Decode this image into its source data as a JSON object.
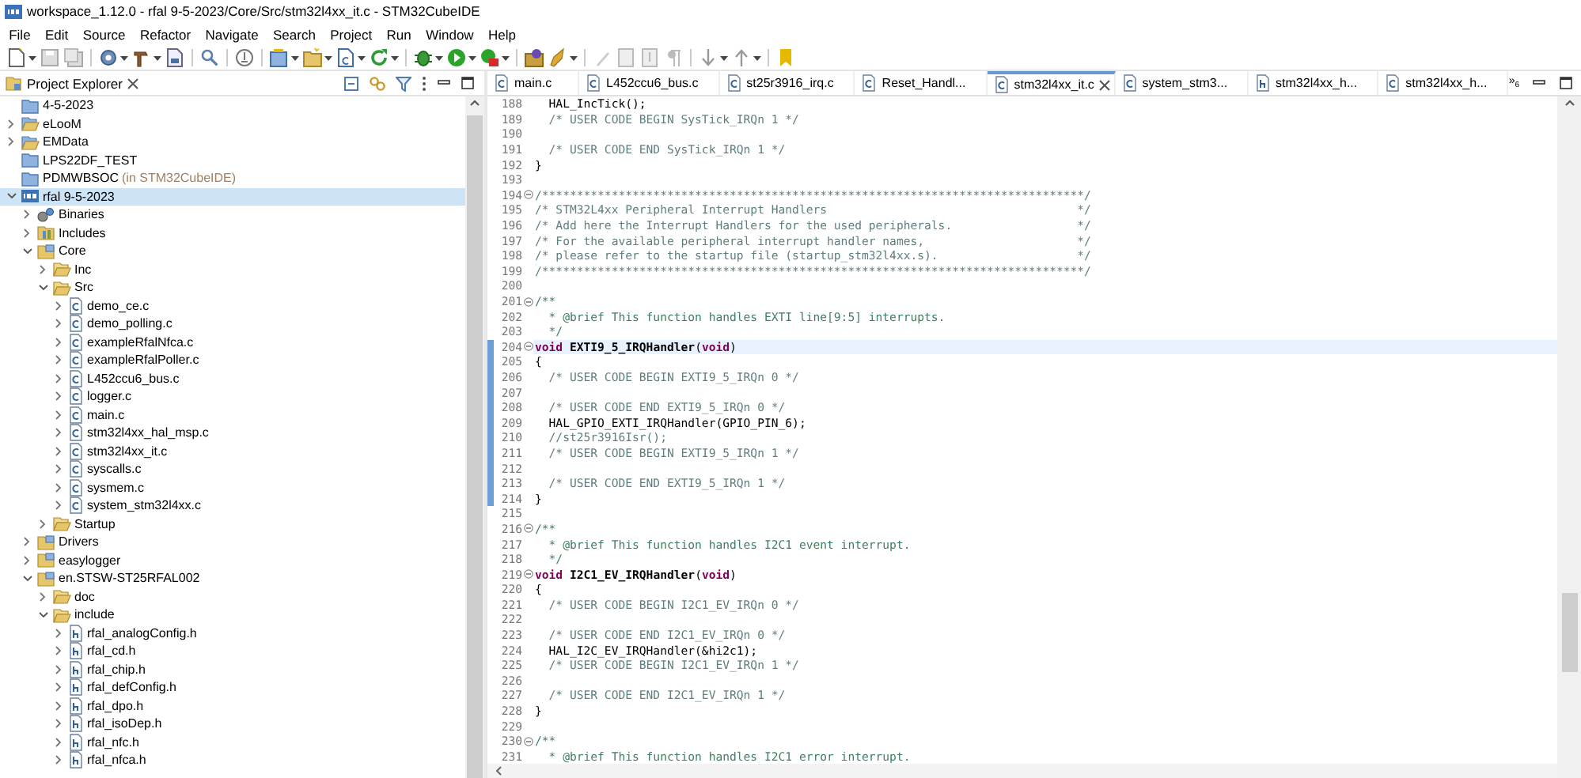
{
  "window": {
    "title": "workspace_1.12.0 - rfal 9-5-2023/Core/Src/stm32l4xx_it.c - STM32CubeIDE"
  },
  "menu": [
    "File",
    "Edit",
    "Source",
    "Refactor",
    "Navigate",
    "Search",
    "Project",
    "Run",
    "Window",
    "Help"
  ],
  "explorer": {
    "title": "Project Explorer",
    "tree": [
      {
        "label": "4-5-2023",
        "kind": "closed-project",
        "selected": false
      },
      {
        "label": "eLooM",
        "kind": "project",
        "expanded": false,
        "selected": false
      },
      {
        "label": "EMData",
        "kind": "project",
        "expanded": false,
        "selected": false
      },
      {
        "label": "LPS22DF_TEST",
        "kind": "closed-project",
        "selected": false
      },
      {
        "label": "PDMWBSOC",
        "note": "(in STM32CubeIDE)",
        "kind": "closed-project",
        "selected": false
      },
      {
        "label": "rfal 9-5-2023",
        "kind": "ide-project",
        "expanded": true,
        "selected": true,
        "children": [
          {
            "label": "Binaries",
            "kind": "binaries",
            "expanded": false,
            "selected": false
          },
          {
            "label": "Includes",
            "kind": "includes",
            "expanded": false,
            "selected": false
          },
          {
            "label": "Core",
            "kind": "source-folder",
            "expanded": true,
            "selected": false,
            "children": [
              {
                "label": "Inc",
                "kind": "folder",
                "expanded": false,
                "selected": false
              },
              {
                "label": "Src",
                "kind": "folder",
                "expanded": true,
                "selected": false,
                "children": [
                  {
                    "label": "demo_ce.c",
                    "kind": "c-file",
                    "expanded": false,
                    "selected": false
                  },
                  {
                    "label": "demo_polling.c",
                    "kind": "c-file",
                    "expanded": false,
                    "selected": false
                  },
                  {
                    "label": "exampleRfalNfca.c",
                    "kind": "c-file",
                    "expanded": false,
                    "selected": false
                  },
                  {
                    "label": "exampleRfalPoller.c",
                    "kind": "c-file",
                    "expanded": false,
                    "selected": false
                  },
                  {
                    "label": "L452ccu6_bus.c",
                    "kind": "c-file",
                    "expanded": false,
                    "selected": false
                  },
                  {
                    "label": "logger.c",
                    "kind": "c-file",
                    "expanded": false,
                    "selected": false
                  },
                  {
                    "label": "main.c",
                    "kind": "c-file",
                    "expanded": false,
                    "selected": false
                  },
                  {
                    "label": "stm32l4xx_hal_msp.c",
                    "kind": "c-file",
                    "expanded": false,
                    "selected": false
                  },
                  {
                    "label": "stm32l4xx_it.c",
                    "kind": "c-file",
                    "expanded": false,
                    "selected": false
                  },
                  {
                    "label": "syscalls.c",
                    "kind": "c-file",
                    "expanded": false,
                    "selected": false
                  },
                  {
                    "label": "sysmem.c",
                    "kind": "c-file",
                    "expanded": false,
                    "selected": false
                  },
                  {
                    "label": "system_stm32l4xx.c",
                    "kind": "c-file",
                    "expanded": false,
                    "selected": false
                  }
                ]
              },
              {
                "label": "Startup",
                "kind": "folder",
                "expanded": false,
                "selected": false
              }
            ]
          },
          {
            "label": "Drivers",
            "kind": "source-folder",
            "expanded": false,
            "selected": false
          },
          {
            "label": "easylogger",
            "kind": "source-folder",
            "expanded": false,
            "selected": false
          },
          {
            "label": "en.STSW-ST25RFAL002",
            "kind": "source-folder",
            "expanded": true,
            "selected": false,
            "children": [
              {
                "label": "doc",
                "kind": "folder",
                "expanded": false,
                "selected": false
              },
              {
                "label": "include",
                "kind": "folder",
                "expanded": true,
                "selected": false,
                "children": [
                  {
                    "label": "rfal_analogConfig.h",
                    "kind": "h-file",
                    "expanded": false,
                    "selected": false
                  },
                  {
                    "label": "rfal_cd.h",
                    "kind": "h-file",
                    "expanded": false,
                    "selected": false
                  },
                  {
                    "label": "rfal_chip.h",
                    "kind": "h-file",
                    "expanded": false,
                    "selected": false
                  },
                  {
                    "label": "rfal_defConfig.h",
                    "kind": "h-file",
                    "expanded": false,
                    "selected": false
                  },
                  {
                    "label": "rfal_dpo.h",
                    "kind": "h-file",
                    "expanded": false,
                    "selected": false
                  },
                  {
                    "label": "rfal_isoDep.h",
                    "kind": "h-file",
                    "expanded": false,
                    "selected": false
                  },
                  {
                    "label": "rfal_nfc.h",
                    "kind": "h-file",
                    "expanded": false,
                    "selected": false
                  },
                  {
                    "label": "rfal_nfca.h",
                    "kind": "h-file",
                    "expanded": false,
                    "selected": false
                  }
                ]
              }
            ]
          }
        ]
      }
    ]
  },
  "editor": {
    "tabs": [
      {
        "label": "main.c",
        "kind": "c-file",
        "selected": false
      },
      {
        "label": "L452ccu6_bus.c",
        "kind": "c-file",
        "selected": false
      },
      {
        "label": "st25r3916_irq.c",
        "kind": "c-file",
        "selected": false
      },
      {
        "label": "Reset_Handl...",
        "kind": "c-file",
        "selected": false
      },
      {
        "label": "stm32l4xx_it.c",
        "kind": "c-file",
        "selected": true
      },
      {
        "label": "system_stm3...",
        "kind": "c-file",
        "selected": false
      },
      {
        "label": "stm32l4xx_h...",
        "kind": "h-file",
        "selected": false
      },
      {
        "label": "stm32l4xx_h...",
        "kind": "c-file",
        "selected": false
      }
    ],
    "overflow": {
      "symbol": "»",
      "count": "6"
    },
    "lines": [
      {
        "number": "188",
        "segments": [
          {
            "kind": "code",
            "text": "  HAL_IncTick();"
          }
        ],
        "fold": false,
        "current": false,
        "changed": false
      },
      {
        "number": "189",
        "segments": [
          {
            "kind": "comment",
            "text": "  /* USER CODE BEGIN SysTick_IRQn 1 */"
          }
        ],
        "fold": false,
        "current": false,
        "changed": false
      },
      {
        "number": "190",
        "fold": false,
        "current": false,
        "changed": false
      },
      {
        "number": "191",
        "segments": [
          {
            "kind": "comment",
            "text": "  /* USER CODE END SysTick_IRQn 1 */"
          }
        ],
        "fold": false,
        "current": false,
        "changed": false
      },
      {
        "number": "192",
        "segments": [
          {
            "kind": "code",
            "text": "}"
          }
        ],
        "fold": false,
        "current": false,
        "changed": false
      },
      {
        "number": "193",
        "fold": false,
        "current": false,
        "changed": false
      },
      {
        "number": "194",
        "segments": [
          {
            "kind": "comment",
            "text": "/******************************************************************************/"
          }
        ],
        "fold": true,
        "current": false,
        "changed": false
      },
      {
        "number": "195",
        "segments": [
          {
            "kind": "comment",
            "text": "/* STM32L4xx Peripheral Interrupt Handlers                                    */"
          }
        ],
        "fold": false,
        "current": false,
        "changed": false
      },
      {
        "number": "196",
        "segments": [
          {
            "kind": "comment",
            "text": "/* Add here the Interrupt Handlers for the used peripherals.                  */"
          }
        ],
        "fold": false,
        "current": false,
        "changed": false
      },
      {
        "number": "197",
        "segments": [
          {
            "kind": "comment",
            "text": "/* For the available peripheral interrupt handler names,                      */"
          }
        ],
        "fold": false,
        "current": false,
        "changed": false
      },
      {
        "number": "198",
        "segments": [
          {
            "kind": "comment",
            "text": "/* please refer to the startup file (startup_stm32l4xx.s).                    */"
          }
        ],
        "fold": false,
        "current": false,
        "changed": false
      },
      {
        "number": "199",
        "segments": [
          {
            "kind": "comment",
            "text": "/******************************************************************************/"
          }
        ],
        "fold": false,
        "current": false,
        "changed": false
      },
      {
        "number": "200",
        "fold": false,
        "current": false,
        "changed": false
      },
      {
        "number": "201",
        "segments": [
          {
            "kind": "doc",
            "text": "/**"
          }
        ],
        "fold": true,
        "current": false,
        "changed": false
      },
      {
        "number": "202",
        "segments": [
          {
            "kind": "doc",
            "text": "  * @brief This function handles EXTI line[9:5] interrupts."
          }
        ],
        "fold": false,
        "current": false,
        "changed": false
      },
      {
        "number": "203",
        "segments": [
          {
            "kind": "doc",
            "text": "  */"
          }
        ],
        "fold": false,
        "current": false,
        "changed": false
      },
      {
        "number": "204",
        "segments": [
          {
            "kind": "keyword",
            "text": "void"
          },
          {
            "kind": "name",
            "text": " EXTI9_5_IRQHandler"
          },
          {
            "kind": "code",
            "text": "("
          },
          {
            "kind": "keyword",
            "text": "void"
          },
          {
            "kind": "code",
            "text": ")"
          }
        ],
        "fold": true,
        "current": true,
        "changed": true
      },
      {
        "number": "205",
        "segments": [
          {
            "kind": "code",
            "text": "{"
          }
        ],
        "fold": false,
        "current": false,
        "changed": true
      },
      {
        "number": "206",
        "segments": [
          {
            "kind": "comment",
            "text": "  /* USER CODE BEGIN EXTI9_5_IRQn 0 */"
          }
        ],
        "fold": false,
        "current": false,
        "changed": true
      },
      {
        "number": "207",
        "fold": false,
        "current": false,
        "changed": true
      },
      {
        "number": "208",
        "segments": [
          {
            "kind": "comment",
            "text": "  /* USER CODE END EXTI9_5_IRQn 0 */"
          }
        ],
        "fold": false,
        "current": false,
        "changed": true
      },
      {
        "number": "209",
        "segments": [
          {
            "kind": "code",
            "text": "  HAL_GPIO_EXTI_IRQHandler(GPIO_PIN_6);"
          }
        ],
        "fold": false,
        "current": false,
        "changed": true
      },
      {
        "number": "210",
        "segments": [
          {
            "kind": "comment",
            "text": "  //st25r3916Isr();"
          }
        ],
        "fold": false,
        "current": false,
        "changed": true
      },
      {
        "number": "211",
        "segments": [
          {
            "kind": "comment",
            "text": "  /* USER CODE BEGIN EXTI9_5_IRQn 1 */"
          }
        ],
        "fold": false,
        "current": false,
        "changed": true
      },
      {
        "number": "212",
        "fold": false,
        "current": false,
        "changed": true
      },
      {
        "number": "213",
        "segments": [
          {
            "kind": "comment",
            "text": "  /* USER CODE END EXTI9_5_IRQn 1 */"
          }
        ],
        "fold": false,
        "current": false,
        "changed": true
      },
      {
        "number": "214",
        "segments": [
          {
            "kind": "code",
            "text": "}"
          }
        ],
        "fold": false,
        "current": false,
        "changed": true
      },
      {
        "number": "215",
        "fold": false,
        "current": false,
        "changed": false
      },
      {
        "number": "216",
        "segments": [
          {
            "kind": "doc",
            "text": "/**"
          }
        ],
        "fold": true,
        "current": false,
        "changed": false
      },
      {
        "number": "217",
        "segments": [
          {
            "kind": "doc",
            "text": "  * @brief This function handles I2C1 event interrupt."
          }
        ],
        "fold": false,
        "current": false,
        "changed": false
      },
      {
        "number": "218",
        "segments": [
          {
            "kind": "doc",
            "text": "  */"
          }
        ],
        "fold": false,
        "current": false,
        "changed": false
      },
      {
        "number": "219",
        "segments": [
          {
            "kind": "keyword",
            "text": "void"
          },
          {
            "kind": "name",
            "text": " I2C1_EV_IRQHandler"
          },
          {
            "kind": "code",
            "text": "("
          },
          {
            "kind": "keyword",
            "text": "void"
          },
          {
            "kind": "code",
            "text": ")"
          }
        ],
        "fold": true,
        "current": false,
        "changed": false
      },
      {
        "number": "220",
        "segments": [
          {
            "kind": "code",
            "text": "{"
          }
        ],
        "fold": false,
        "current": false,
        "changed": false
      },
      {
        "number": "221",
        "segments": [
          {
            "kind": "comment",
            "text": "  /* USER CODE BEGIN I2C1_EV_IRQn 0 */"
          }
        ],
        "fold": false,
        "current": false,
        "changed": false
      },
      {
        "number": "222",
        "fold": false,
        "current": false,
        "changed": false
      },
      {
        "number": "223",
        "segments": [
          {
            "kind": "comment",
            "text": "  /* USER CODE END I2C1_EV_IRQn 0 */"
          }
        ],
        "fold": false,
        "current": false,
        "changed": false
      },
      {
        "number": "224",
        "segments": [
          {
            "kind": "code",
            "text": "  HAL_I2C_EV_IRQHandler(&hi2c1);"
          }
        ],
        "fold": false,
        "current": false,
        "changed": false
      },
      {
        "number": "225",
        "segments": [
          {
            "kind": "comment",
            "text": "  /* USER CODE BEGIN I2C1_EV_IRQn 1 */"
          }
        ],
        "fold": false,
        "current": false,
        "changed": false
      },
      {
        "number": "226",
        "fold": false,
        "current": false,
        "changed": false
      },
      {
        "number": "227",
        "segments": [
          {
            "kind": "comment",
            "text": "  /* USER CODE END I2C1_EV_IRQn 1 */"
          }
        ],
        "fold": false,
        "current": false,
        "changed": false
      },
      {
        "number": "228",
        "segments": [
          {
            "kind": "code",
            "text": "}"
          }
        ],
        "fold": false,
        "current": false,
        "changed": false
      },
      {
        "number": "229",
        "fold": false,
        "current": false,
        "changed": false
      },
      {
        "number": "230",
        "segments": [
          {
            "kind": "doc",
            "text": "/**"
          }
        ],
        "fold": true,
        "current": false,
        "changed": false
      },
      {
        "number": "231",
        "segments": [
          {
            "kind": "doc",
            "text": "  * @brief This function handles I2C1 error interrupt."
          }
        ],
        "fold": false,
        "current": false,
        "changed": false
      }
    ]
  }
}
